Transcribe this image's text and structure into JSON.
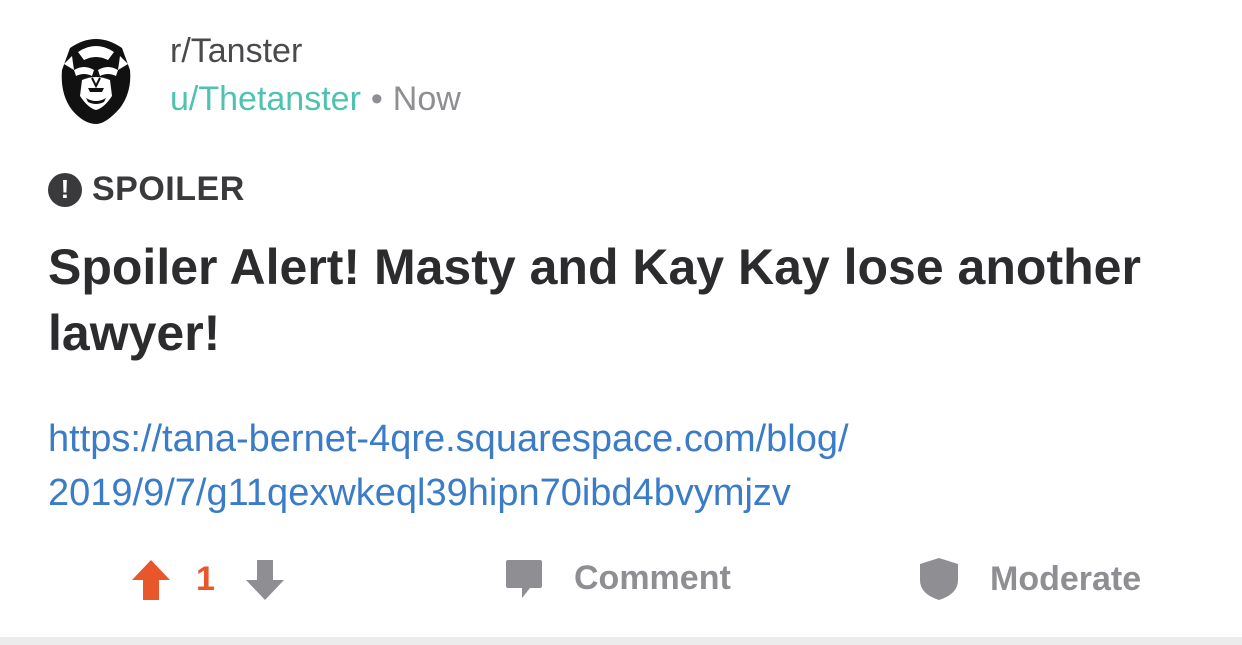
{
  "post": {
    "subreddit": "r/Tanster",
    "username": "u/Thetanster",
    "separator": "•",
    "time": "Now",
    "flair": "SPOILER",
    "flair_icon": "!",
    "title": "Spoiler Alert! Masty and Kay Kay lose another lawyer!",
    "link_line1": "https://tana-bernet-4qre.squarespace.com/blog/",
    "link_line2": "2019/9/7/g11qexwkeql39hipn70ibd4bvymjzv",
    "link_url": "https://tana-bernet-4qre.squarespace.com/blog/2019/9/7/g11qexwkeql39hipn70ibd4bvymjzv"
  },
  "actions": {
    "score": "1",
    "comment_label": "Comment",
    "moderate_label": "Moderate"
  },
  "colors": {
    "upvote_active": "#e8572c",
    "username": "#4fc3b0",
    "link": "#3a7cc7",
    "muted": "#8e8e93"
  },
  "icons": {
    "avatar": "masked-face-avatar",
    "flair": "exclamation-circle-icon",
    "upvote": "arrow-up-icon",
    "downvote": "arrow-down-icon",
    "comment": "speech-bubble-icon",
    "moderate": "shield-icon"
  }
}
